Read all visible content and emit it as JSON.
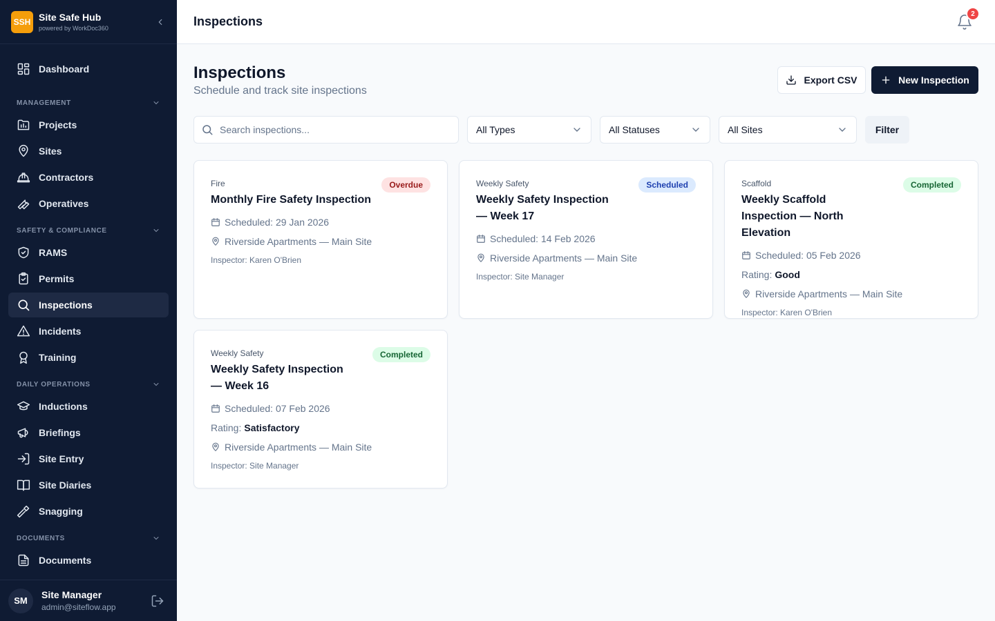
{
  "app": {
    "logo": "SSH",
    "name": "Site Safe Hub",
    "powered_by": "powered by WorkDoc360"
  },
  "sidebar": {
    "dashboard": "Dashboard",
    "sections": {
      "management": "MANAGEMENT",
      "safety": "SAFETY & COMPLIANCE",
      "daily": "DAILY OPERATIONS",
      "documents": "DOCUMENTS"
    },
    "items": {
      "projects": "Projects",
      "sites": "Sites",
      "contractors": "Contractors",
      "operatives": "Operatives",
      "rams": "RAMS",
      "permits": "Permits",
      "inspections": "Inspections",
      "incidents": "Incidents",
      "training": "Training",
      "inductions": "Inductions",
      "briefings": "Briefings",
      "site_entry": "Site Entry",
      "site_diaries": "Site Diaries",
      "snagging": "Snagging",
      "documents": "Documents"
    },
    "active": "inspections"
  },
  "user": {
    "initials": "SM",
    "name": "Site Manager",
    "email": "admin@siteflow.app"
  },
  "header": {
    "title": "Inspections",
    "notifications": "2"
  },
  "page": {
    "title": "Inspections",
    "subtitle": "Schedule and track site inspections",
    "export_label": "Export CSV",
    "new_label": "New Inspection"
  },
  "filters": {
    "search_placeholder": "Search inspections...",
    "types": "All Types",
    "statuses": "All Statuses",
    "sites": "All Sites",
    "filter_label": "Filter"
  },
  "colors": {
    "sidebar_bg": "#0f1b33",
    "brand_accent": "#f59e0b",
    "overdue": "#991b1b",
    "scheduled": "#1e40af",
    "completed": "#166534"
  },
  "cards": [
    {
      "type": "Fire",
      "title": "Monthly Fire Safety Inspection",
      "status": "Overdue",
      "scheduled": "Scheduled: 29 Jan 2026",
      "location": "Riverside Apartments — Main Site",
      "inspector": "Inspector: Karen O'Brien"
    },
    {
      "type": "Weekly Safety",
      "title": "Weekly Safety Inspection — Week 17",
      "status": "Scheduled",
      "scheduled": "Scheduled: 14 Feb 2026",
      "location": "Riverside Apartments — Main Site",
      "inspector": "Inspector: Site Manager"
    },
    {
      "type": "Scaffold",
      "title": "Weekly Scaffold Inspection — North Elevation",
      "status": "Completed",
      "scheduled": "Scheduled: 05 Feb 2026",
      "rating_label": "Rating:",
      "rating": "Good",
      "location": "Riverside Apartments — Main Site",
      "inspector": "Inspector: Karen O'Brien"
    },
    {
      "type": "Weekly Safety",
      "title": "Weekly Safety Inspection — Week 16",
      "status": "Completed",
      "scheduled": "Scheduled: 07 Feb 2026",
      "rating_label": "Rating:",
      "rating": "Satisfactory",
      "location": "Riverside Apartments — Main Site",
      "inspector": "Inspector: Site Manager"
    }
  ]
}
